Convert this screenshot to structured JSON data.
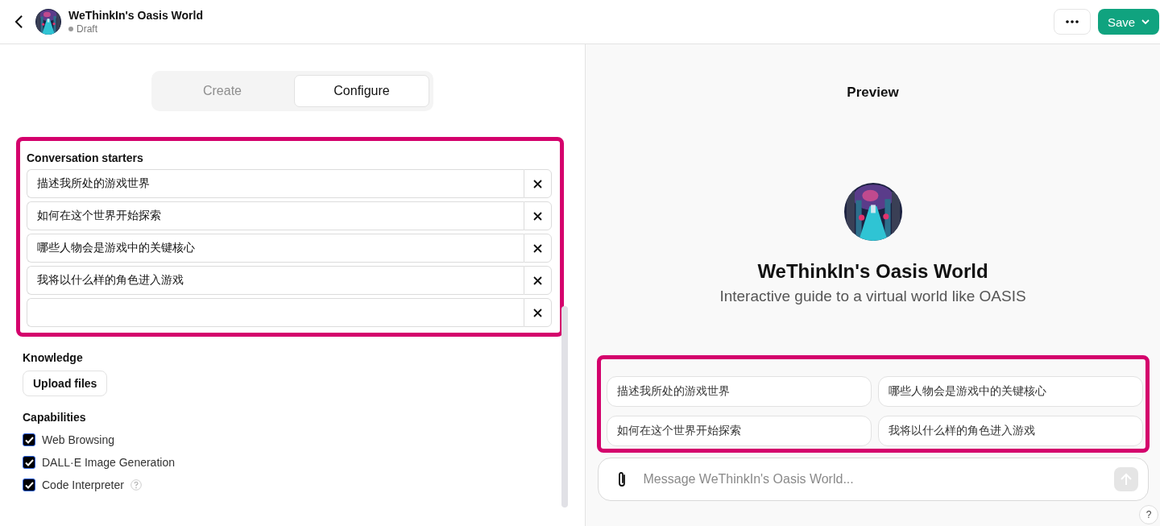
{
  "header": {
    "title": "WeThinkIn's Oasis World",
    "status": "Draft"
  },
  "tabs": [
    {
      "label": "Create",
      "selected": false
    },
    {
      "label": "Configure",
      "selected": true
    }
  ],
  "conversation_starters": {
    "label": "Conversation starters",
    "highlighted": true,
    "items": [
      {
        "kind": "filled",
        "text": "描述我所处的游戏世界"
      },
      {
        "kind": "filled",
        "text": "如何在这个世界开始探索"
      },
      {
        "kind": "filled",
        "text": "哪些人物会是游戏中的关键核心"
      },
      {
        "kind": "filled",
        "text": "我将以什么样的角色进入游戏"
      },
      {
        "kind": "empty"
      }
    ]
  },
  "knowledge": {
    "label": "Knowledge",
    "button": "Upload files"
  },
  "capabilities": {
    "label": "Capabilities",
    "items": [
      {
        "label": "Web Browsing",
        "checked": true
      },
      {
        "label": "DALL·E Image Generation",
        "checked": true
      },
      {
        "label": "Code Interpreter",
        "checked": true,
        "help": true
      }
    ]
  },
  "preview": {
    "title": "Preview",
    "name": "WeThinkIn's Oasis World",
    "description": "Interactive guide to a virtual world like OASIS",
    "highlighted": true,
    "starters": [
      "描述我所处的游戏世界",
      "哪些人物会是游戏中的关键核心",
      "如何在这个世界开始探索",
      "我将以什么样的角色进入游戏"
    ],
    "message_placeholder": "Message WeThinkIn's Oasis World...",
    "help": "?"
  },
  "save_button": "Save"
}
